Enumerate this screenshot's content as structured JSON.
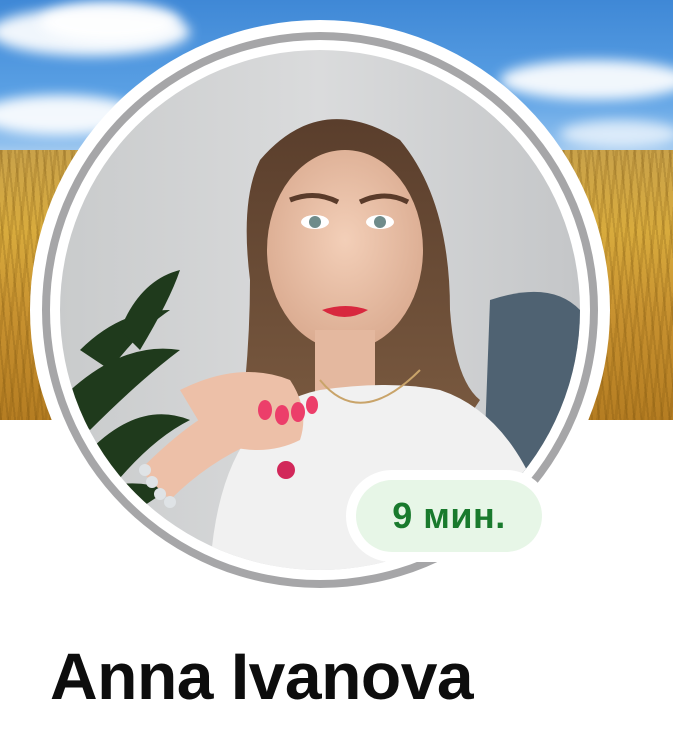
{
  "profile": {
    "name": "Anna Ivanova",
    "last_seen": "9 мин."
  },
  "colors": {
    "badge_text": "#197a2d",
    "badge_bg": "#e7f6e7",
    "ring": "#a6a6a8"
  }
}
